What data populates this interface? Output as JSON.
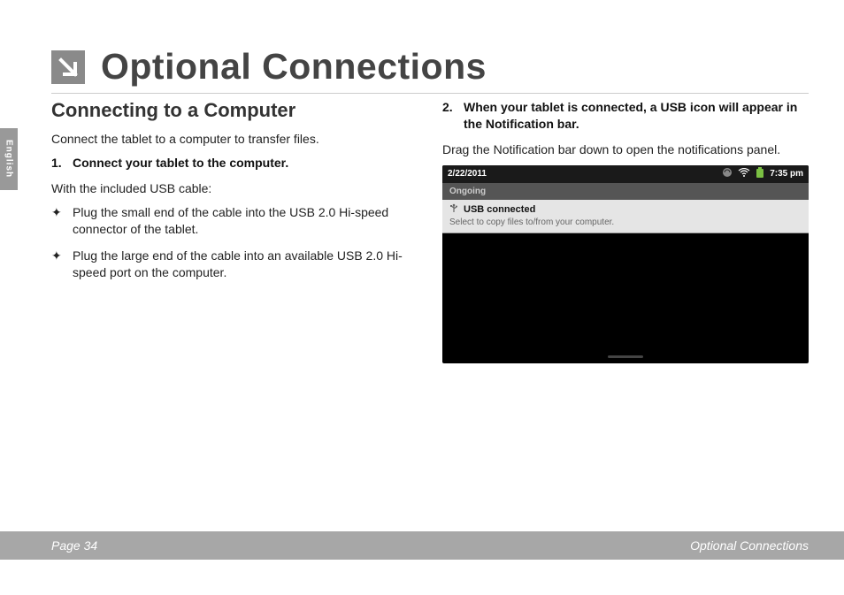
{
  "lang_tab": "English",
  "header": {
    "title": "Optional Connections"
  },
  "left": {
    "subheading": "Connecting to a Computer",
    "intro": "Connect the tablet to a computer to transfer files.",
    "step1_num": "1.",
    "step1_text": "Connect your tablet to the computer.",
    "usb_intro": "With the included USB cable:",
    "bullets": [
      "Plug the small end of the cable into the USB 2.0 Hi-speed connector of the tablet.",
      "Plug the large end of the cable into an available USB 2.0 Hi-speed port on the computer."
    ]
  },
  "right": {
    "step2_num": "2.",
    "step2_text": "When your tablet is connected, a USB icon will appear in the Notification bar.",
    "drag_text": "Drag the Notification bar down to open the notifications panel."
  },
  "tablet": {
    "date": "2/22/2011",
    "time": "7:35 pm",
    "ongoing_label": "Ongoing",
    "notif_title": "USB connected",
    "notif_sub": "Select to copy files to/from your computer."
  },
  "footer": {
    "page": "Page 34",
    "section": "Optional Connections"
  }
}
